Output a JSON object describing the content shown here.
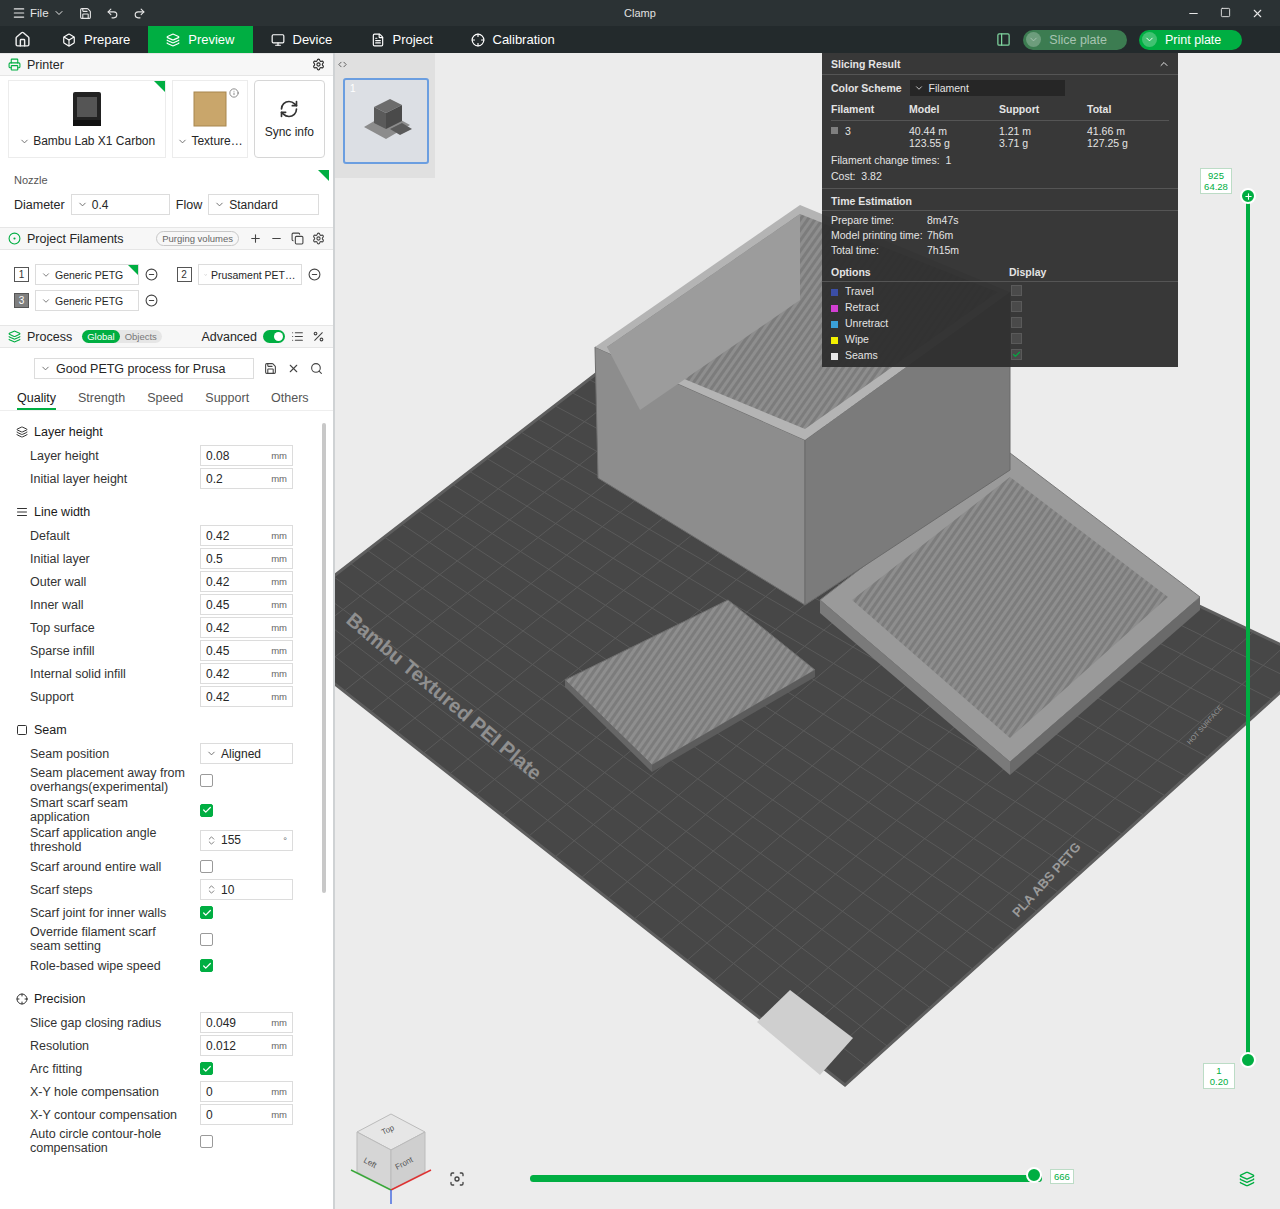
{
  "window": {
    "title": "Clamp",
    "menu": "File"
  },
  "nav_tabs": [
    {
      "label": "Prepare",
      "selected": false
    },
    {
      "label": "Preview",
      "selected": true
    },
    {
      "label": "Device",
      "selected": false
    },
    {
      "label": "Project",
      "selected": false
    },
    {
      "label": "Calibration",
      "selected": false
    }
  ],
  "actions": [
    {
      "label": "Slice plate",
      "disabled": true
    },
    {
      "label": "Print plate",
      "disabled": false
    }
  ],
  "printer": {
    "header": "Printer",
    "cards": [
      {
        "label": "Bambu Lab X1 Carbon",
        "marked": true
      },
      {
        "label": "Texture…",
        "marked": false
      }
    ],
    "sync": "Sync info"
  },
  "nozzle": {
    "label": "Nozzle",
    "diameter_label": "Diameter",
    "diameter": "0.4",
    "flow_label": "Flow",
    "flow": "Standard",
    "marked": true
  },
  "filaments": {
    "header": "Project Filaments",
    "badge": "Purging volumes",
    "items": [
      {
        "index": "1",
        "name": "Generic PETG",
        "color": "#ffffff",
        "marked": true
      },
      {
        "index": "2",
        "name": "Prusament PET…",
        "color": "#ffffff",
        "marked": false
      },
      {
        "index": "3",
        "name": "Generic PETG",
        "color": "#7f7f7f",
        "marked": false
      }
    ]
  },
  "process": {
    "header": "Process",
    "scope": [
      {
        "label": "Global",
        "selected": true
      },
      {
        "label": "Objects",
        "selected": false
      }
    ],
    "advanced_label": "Advanced",
    "advanced": true,
    "preset": "Good PETG process for Prusa"
  },
  "settings_tabs": [
    {
      "label": "Quality",
      "selected": true
    },
    {
      "label": "Strength",
      "selected": false
    },
    {
      "label": "Speed",
      "selected": false
    },
    {
      "label": "Support",
      "selected": false
    },
    {
      "label": "Others",
      "selected": false
    }
  ],
  "sections": [
    {
      "title": "Layer height",
      "rows": [
        {
          "kind": "input",
          "label": "Layer height",
          "value": "0.08",
          "unit": "mm"
        },
        {
          "kind": "input",
          "label": "Initial layer height",
          "value": "0.2",
          "unit": "mm"
        }
      ]
    },
    {
      "title": "Line width",
      "rows": [
        {
          "kind": "input",
          "label": "Default",
          "value": "0.42",
          "unit": "mm"
        },
        {
          "kind": "input",
          "label": "Initial layer",
          "value": "0.5",
          "unit": "mm"
        },
        {
          "kind": "input",
          "label": "Outer wall",
          "value": "0.42",
          "unit": "mm"
        },
        {
          "kind": "input",
          "label": "Inner wall",
          "value": "0.45",
          "unit": "mm"
        },
        {
          "kind": "input",
          "label": "Top surface",
          "value": "0.42",
          "unit": "mm"
        },
        {
          "kind": "input",
          "label": "Sparse infill",
          "value": "0.45",
          "unit": "mm"
        },
        {
          "kind": "input",
          "label": "Internal solid infill",
          "value": "0.42",
          "unit": "mm"
        },
        {
          "kind": "input",
          "label": "Support",
          "value": "0.42",
          "unit": "mm"
        }
      ]
    },
    {
      "title": "Seam",
      "rows": [
        {
          "kind": "dropdown",
          "label": "Seam position",
          "value": "Aligned"
        },
        {
          "kind": "checkbox",
          "label": "Seam placement away from overhangs(experimental)",
          "checked": false
        },
        {
          "kind": "checkbox",
          "label": "Smart scarf seam application",
          "checked": true
        },
        {
          "kind": "spin",
          "label": "Scarf application angle threshold",
          "value": "155",
          "unit": "°"
        },
        {
          "kind": "checkbox",
          "label": "Scarf around entire wall",
          "checked": false
        },
        {
          "kind": "spin",
          "label": "Scarf steps",
          "value": "10",
          "unit": ""
        },
        {
          "kind": "checkbox",
          "label": "Scarf joint for inner walls",
          "checked": true
        },
        {
          "kind": "checkbox",
          "label": "Override filament scarf seam setting",
          "checked": false
        },
        {
          "kind": "checkbox",
          "label": "Role-based wipe speed",
          "checked": true
        }
      ]
    },
    {
      "title": "Precision",
      "rows": [
        {
          "kind": "input",
          "label": "Slice gap closing radius",
          "value": "0.049",
          "unit": "mm"
        },
        {
          "kind": "input",
          "label": "Resolution",
          "value": "0.012",
          "unit": "mm"
        },
        {
          "kind": "checkbox",
          "label": "Arc fitting",
          "checked": true
        },
        {
          "kind": "input",
          "label": "X-Y hole compensation",
          "value": "0",
          "unit": "mm"
        },
        {
          "kind": "input",
          "label": "X-Y contour compensation",
          "value": "0",
          "unit": "mm"
        },
        {
          "kind": "checkbox",
          "label": "Auto circle contour-hole compensation",
          "checked": false
        }
      ]
    }
  ],
  "slicing_result": {
    "title": "Slicing Result",
    "scheme_label": "Color Scheme",
    "scheme": "Filament",
    "columns": [
      "Filament",
      "Model",
      "Support",
      "Total"
    ],
    "rows": [
      {
        "filament": "3",
        "color": "#7f7f7f",
        "model": [
          "40.44 m",
          "123.55 g"
        ],
        "support": [
          "1.21 m",
          "3.71 g"
        ],
        "total": [
          "41.66 m",
          "127.25 g"
        ]
      }
    ],
    "stats": [
      {
        "label": "Filament change times:",
        "value": "1"
      },
      {
        "label": "Cost:",
        "value": "3.82"
      }
    ],
    "time_title": "Time Estimation",
    "times": [
      {
        "label": "Prepare time:",
        "value": "8m47s"
      },
      {
        "label": "Model printing time:",
        "value": "7h6m"
      },
      {
        "label": "Total time:",
        "value": "7h15m"
      }
    ],
    "options_title": "Options",
    "display_title": "Display",
    "options": [
      {
        "label": "Travel",
        "color": "#3b4ea6",
        "checked": false
      },
      {
        "label": "Retract",
        "color": "#d23fd2",
        "checked": false
      },
      {
        "label": "Unretract",
        "color": "#3aa0d8",
        "checked": false
      },
      {
        "label": "Wipe",
        "color": "#f2f000",
        "checked": false
      },
      {
        "label": "Seams",
        "color": "#e8e8e8",
        "checked": true
      }
    ]
  },
  "plate": {
    "number": "1",
    "label": "Bambu Textured PEI Plate",
    "marking": "PLA ABS PETG",
    "warning": "HOT SURFACE"
  },
  "layer_slider": {
    "top": "925",
    "top_height": "64.28",
    "bottom": "1",
    "bottom_height": "0.20",
    "level": 1
  },
  "move_slider": {
    "value": "666",
    "level": 1
  },
  "view_cube": {
    "top": "Top",
    "left": "Left",
    "front": "Front"
  }
}
